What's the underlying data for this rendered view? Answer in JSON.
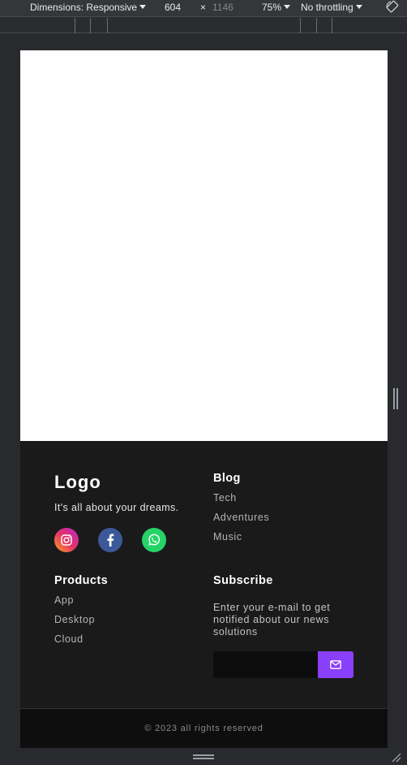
{
  "devtools": {
    "dimensions_label": "Dimensions: Responsive",
    "width": "604",
    "times": "×",
    "height": "1146",
    "zoom": "75%",
    "throttling": "No throttling"
  },
  "footer": {
    "logo": "Logo",
    "tagline": "It's all about your dreams.",
    "social": [
      {
        "name": "instagram",
        "color": "#e5316a"
      },
      {
        "name": "facebook",
        "color": "#3b5998"
      },
      {
        "name": "whatsapp",
        "color": "#25d366"
      }
    ],
    "blog": {
      "heading": "Blog",
      "links": [
        "Tech",
        "Adventures",
        "Music"
      ]
    },
    "products": {
      "heading": "Products",
      "links": [
        "App",
        "Desktop",
        "Cloud"
      ]
    },
    "subscribe": {
      "heading": "Subscribe",
      "text": "Enter your e-mail to get notified about our news solutions",
      "email_value": "",
      "button_icon": "mail-icon",
      "button_color": "#8a3ffc"
    },
    "copyright": "© 2023 all rights reserved"
  }
}
